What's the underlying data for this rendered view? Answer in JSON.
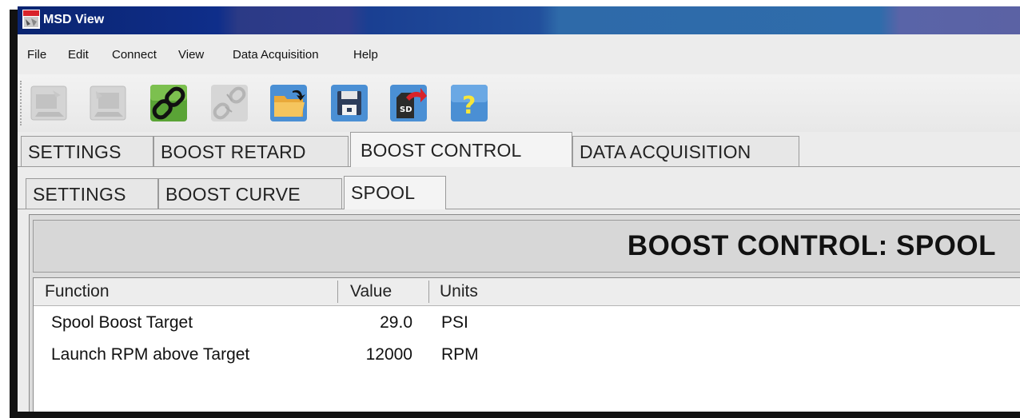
{
  "window": {
    "title": "MSD View",
    "title_color": "#ffffff"
  },
  "menu": [
    "File",
    "Edit",
    "Connect",
    "View",
    "Data Acquisition",
    "Help"
  ],
  "toolbar": {
    "icons": [
      "upload-disabled-icon",
      "download-disabled-icon",
      "connect-chain-icon",
      "disconnect-disabled-icon",
      "open-folder-icon",
      "save-floppy-icon",
      "sd-card-export-icon",
      "help-icon"
    ]
  },
  "tabs": {
    "main": [
      "SETTINGS",
      "BOOST RETARD",
      "BOOST CONTROL",
      "DATA ACQUISITION"
    ],
    "main_active": "BOOST CONTROL",
    "sub": [
      "SETTINGS",
      "BOOST CURVE",
      "SPOOL"
    ],
    "sub_active": "SPOOL"
  },
  "panel": {
    "title": "BOOST CONTROL:  SPOOL"
  },
  "table": {
    "columns": [
      "Function",
      "Value",
      "Units"
    ],
    "rows": [
      {
        "function": "Spool Boost Target",
        "value": "29.0",
        "units": "PSI"
      },
      {
        "function": "Launch RPM above Target",
        "value": "12000",
        "units": "RPM"
      }
    ]
  },
  "colors": {
    "accent": "#0f2e8a",
    "panel_bg": "#dcdcdc",
    "chain_green": "#5aa436"
  }
}
